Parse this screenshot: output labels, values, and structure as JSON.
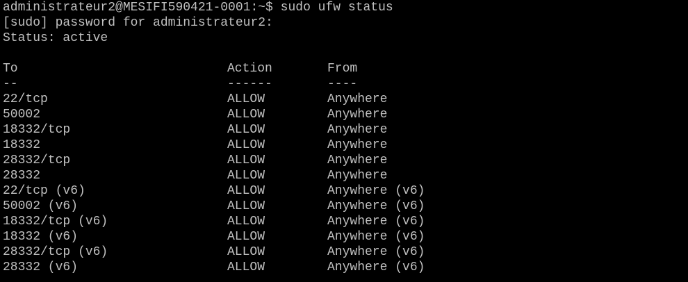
{
  "window": {
    "text_color": "#c0c0c0",
    "background_color": "#000000"
  },
  "lines": {
    "prompt": "administrateur2@MESIFI590421-0001:~$ sudo ufw status",
    "sudo_prompt": "[sudo] password for administrateur2:",
    "status": "Status: active"
  },
  "table": {
    "headers": {
      "to": "To",
      "action": "Action",
      "from": "From"
    },
    "separators": {
      "to": "--",
      "action": "------",
      "from": "----"
    },
    "rows": [
      {
        "to": "22/tcp",
        "action": "ALLOW",
        "from": "Anywhere"
      },
      {
        "to": "50002",
        "action": "ALLOW",
        "from": "Anywhere"
      },
      {
        "to": "18332/tcp",
        "action": "ALLOW",
        "from": "Anywhere"
      },
      {
        "to": "18332",
        "action": "ALLOW",
        "from": "Anywhere"
      },
      {
        "to": "28332/tcp",
        "action": "ALLOW",
        "from": "Anywhere"
      },
      {
        "to": "28332",
        "action": "ALLOW",
        "from": "Anywhere"
      },
      {
        "to": "22/tcp (v6)",
        "action": "ALLOW",
        "from": "Anywhere (v6)"
      },
      {
        "to": "50002 (v6)",
        "action": "ALLOW",
        "from": "Anywhere (v6)"
      },
      {
        "to": "18332/tcp (v6)",
        "action": "ALLOW",
        "from": "Anywhere (v6)"
      },
      {
        "to": "18332 (v6)",
        "action": "ALLOW",
        "from": "Anywhere (v6)"
      },
      {
        "to": "28332/tcp (v6)",
        "action": "ALLOW",
        "from": "Anywhere (v6)"
      },
      {
        "to": "28332 (v6)",
        "action": "ALLOW",
        "from": "Anywhere (v6)"
      }
    ]
  }
}
